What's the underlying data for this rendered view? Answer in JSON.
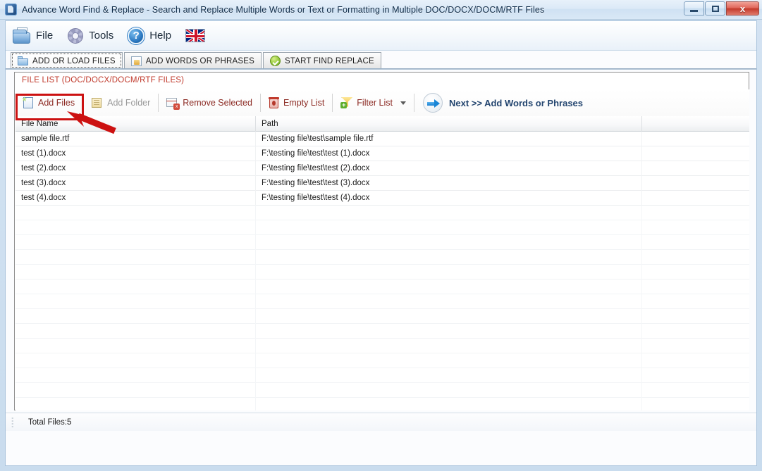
{
  "window": {
    "title": "Advance Word Find & Replace - Search and Replace Multiple Words or Text  or Formatting in Multiple DOC/DOCX/DOCM/RTF Files",
    "icon": "app-icon",
    "controls": {
      "minimize": "minimize-button",
      "maximize": "maximize-button",
      "close_label": "x"
    }
  },
  "menu": {
    "items": [
      {
        "label": "File",
        "icon": "folder-icon"
      },
      {
        "label": "Tools",
        "icon": "gear-icon"
      },
      {
        "label": "Help",
        "icon": "question-icon"
      }
    ],
    "language_flag": "uk-flag-icon"
  },
  "tabs": [
    {
      "label": "ADD OR LOAD FILES",
      "icon": "folder-icon",
      "selected": true
    },
    {
      "label": "ADD WORDS OR PHRASES",
      "icon": "words-icon",
      "selected": false
    },
    {
      "label": "START FIND REPLACE",
      "icon": "check-icon",
      "selected": false
    }
  ],
  "panel": {
    "title": "FILE LIST (DOC/DOCX/DOCM/RTF FILES)",
    "title_color": "#c0392b",
    "toolbar": {
      "add_files": "Add Files",
      "add_folder": "Add Folder",
      "remove_selected": "Remove Selected",
      "empty_list": "Empty List",
      "filter_list": "Filter List",
      "next": "Next >> Add Words or Phrases",
      "button_color": "#8c2b24",
      "next_color": "#23456f"
    },
    "grid": {
      "columns": [
        "File Name",
        "Path",
        ""
      ],
      "rows": [
        {
          "file_name": "sample file.rtf",
          "path": "F:\\testing file\\test\\sample file.rtf",
          "extra": ""
        },
        {
          "file_name": "test (1).docx",
          "path": "F:\\testing file\\test\\test (1).docx",
          "extra": ""
        },
        {
          "file_name": "test (2).docx",
          "path": "F:\\testing file\\test\\test (2).docx",
          "extra": ""
        },
        {
          "file_name": "test (3).docx",
          "path": "F:\\testing file\\test\\test (3).docx",
          "extra": ""
        },
        {
          "file_name": "test (4).docx",
          "path": "F:\\testing file\\test\\test (4).docx",
          "extra": ""
        }
      ]
    }
  },
  "status": {
    "total_files": "Total Files:5"
  },
  "annotation": {
    "highlight_target": "Add Files",
    "color": "#cc1111"
  }
}
